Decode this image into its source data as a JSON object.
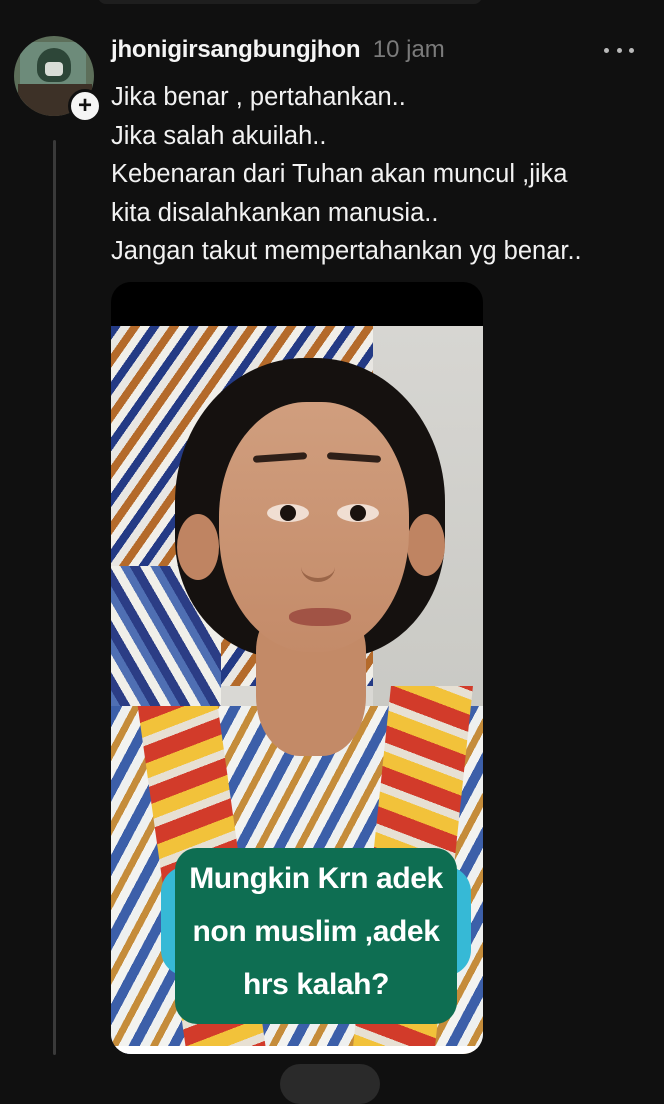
{
  "post": {
    "username": "jhonigirsangbungjhon",
    "timestamp": "10 jam",
    "lines": [
      "Jika benar , pertahankan..",
      "Jika salah akuilah..",
      "Kebenaran dari Tuhan akan muncul ,jika",
      "kita disalahkankan manusia..",
      "Jangan takut mempertahankan yg benar.."
    ],
    "follow_badge": "+",
    "media": {
      "caption_lines": [
        "Mungkin Krn adek",
        "non muslim ,adek",
        "hrs kalah?"
      ],
      "colors": {
        "caption_bg": "#0e6e52",
        "caption_glow": "#36b9d6"
      }
    }
  },
  "icons": {
    "more": "more-horizontal-icon",
    "follow": "plus-icon"
  },
  "colors": {
    "background": "#101010",
    "text": "#f2f2f2",
    "muted": "#7b7b7b",
    "thread_line": "#3a3a3a"
  }
}
